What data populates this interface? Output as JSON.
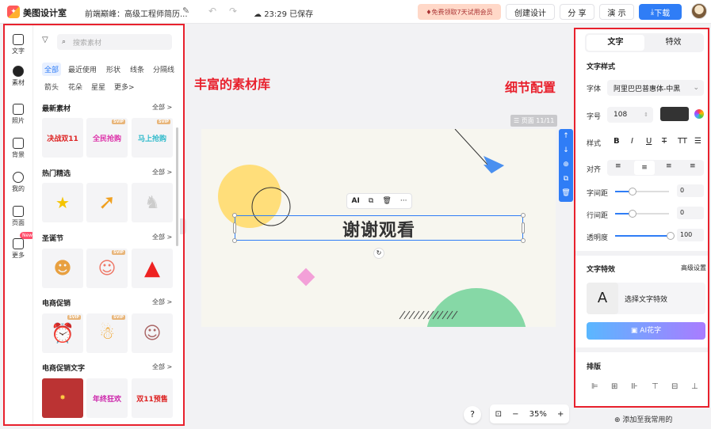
{
  "header": {
    "app_name": "美图设计室",
    "doc_title": "前端巅峰：高级工程师简历...",
    "save_status": "23:29 已保存",
    "promo_label": "免费领取7天试用会员",
    "create_label": "创建设计",
    "share_label": "分 享",
    "present_label": "演 示",
    "download_label": "下载"
  },
  "left_nav": {
    "items": [
      {
        "label": "文字"
      },
      {
        "label": "素材"
      },
      {
        "label": "照片"
      },
      {
        "label": "背景"
      },
      {
        "label": "我的"
      },
      {
        "label": "页面"
      },
      {
        "label": "更多"
      }
    ],
    "new_badge": "New"
  },
  "material_panel": {
    "search_placeholder": "搜索素材",
    "tags": [
      "全部",
      "最近使用",
      "形状",
      "线条",
      "分隔线",
      "箭头",
      "花朵",
      "星星",
      "更多>"
    ],
    "all_label": "全部 >",
    "sections": [
      {
        "title": "最新素材",
        "thumbs": [
          "决战双11",
          "全民抢购",
          "马上抢购"
        ]
      },
      {
        "title": "热门精选",
        "thumbs": [
          "",
          "",
          ""
        ]
      },
      {
        "title": "圣诞节",
        "thumbs": [
          "",
          "",
          ""
        ]
      },
      {
        "title": "电商促销",
        "thumbs": [
          "",
          "",
          ""
        ]
      },
      {
        "title": "电商促销文字",
        "thumbs": [
          "",
          "年终狂欢",
          "双11预售"
        ]
      }
    ],
    "svip_label": "SVIP"
  },
  "annotations": {
    "left": "丰富的素材库",
    "right": "细节配置"
  },
  "canvas": {
    "page_indicator": "页面 11/11",
    "main_text": "谢谢观看",
    "context_ai": "AI"
  },
  "zoom": {
    "help": "?",
    "value": "35%",
    "minus": "−",
    "plus": "+"
  },
  "right_panel": {
    "tab_text": "文字",
    "tab_effect": "特效",
    "text_style_title": "文字样式",
    "font_label": "字体",
    "font_value": "阿里巴巴普惠体-中黑",
    "size_label": "字号",
    "size_value": "108",
    "style_label": "样式",
    "align_label": "对齐",
    "letter_spacing_label": "字间距",
    "letter_spacing_value": "0",
    "line_spacing_label": "行间距",
    "line_spacing_value": "0",
    "opacity_label": "透明度",
    "opacity_value": "100",
    "effect_title": "文字特效",
    "advanced_label": "高级设置",
    "effect_sample": "A",
    "choose_effect": "选择文字特效",
    "ai_flower": "AI花字",
    "layout_title": "排版",
    "text_color": "#333333"
  },
  "add_common": "添加至我常用的"
}
